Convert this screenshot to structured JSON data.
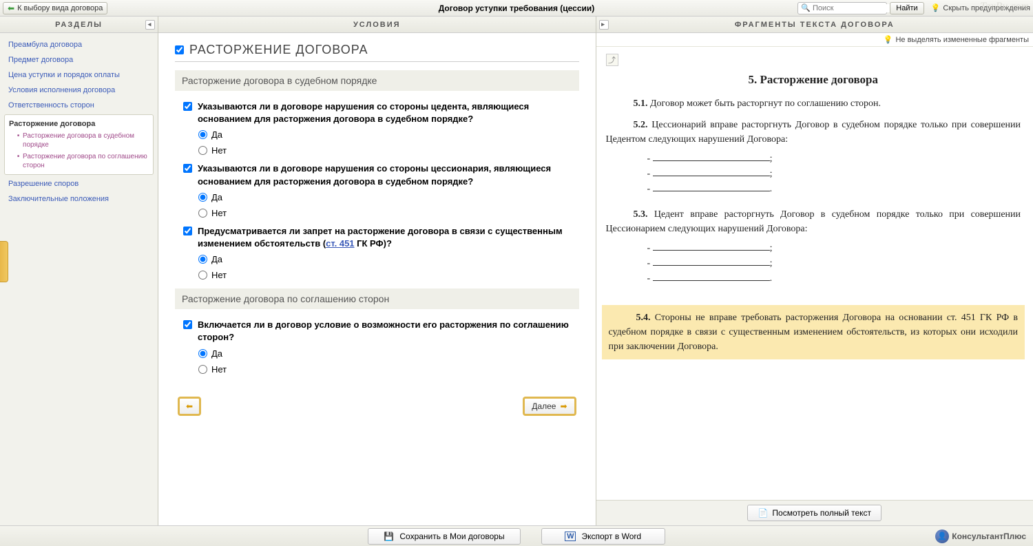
{
  "topbar": {
    "back_label": "К выбору вида договора",
    "title": "Договор уступки требования (цессии)",
    "search_placeholder": "Поиск",
    "find_label": "Найти",
    "hide_warnings": "Скрыть предупреждения",
    "watermark": "TaxRu.com"
  },
  "columns": {
    "sidebar_header": "РАЗДЕЛЫ",
    "conditions_header": "УСЛОВИЯ",
    "fragments_header": "ФРАГМЕНТЫ ТЕКСТА ДОГОВОРА"
  },
  "sidebar": {
    "items": [
      "Преамбула договора",
      "Предмет договора",
      "Цена уступки и порядок оплаты",
      "Условия исполнения договора",
      "Ответственность сторон"
    ],
    "active": {
      "title": "Расторжение договора",
      "subs": [
        "Расторжение договора в судебном порядке",
        "Расторжение договора по соглашению сторон"
      ]
    },
    "after": [
      "Разрешение споров",
      "Заключительные положения"
    ]
  },
  "conditions": {
    "title": "РАСТОРЖЕНИЕ ДОГОВОРА",
    "sub1": "Расторжение договора в судебном порядке",
    "q1": "Указываются ли в договоре нарушения со стороны цедента, являющиеся основанием для расторжения договора в судебном порядке?",
    "q2": "Указываются ли в договоре нарушения со стороны цессионария, являющиеся основанием для расторжения договора в судебном порядке?",
    "q3_a": "Предусматривается ли запрет на расторжение договора в связи с существенным изменением обстоятельств (",
    "q3_link": "ст. 451",
    "q3_b": " ГК РФ)?",
    "sub2": "Расторжение договора по соглашению сторон",
    "q4": "Включается ли в договор условие о возможности его расторжения по соглашению сторон?",
    "yes": "Да",
    "no": "Нет",
    "next": "Далее"
  },
  "fragments": {
    "no_highlight": "Не выделять измененные фрагменты",
    "heading_num": "5.",
    "heading": "Расторжение договора",
    "p51_num": "5.1.",
    "p51": "Договор может быть расторгнут по соглашению сторон.",
    "p52_num": "5.2.",
    "p52": "Цессионарий вправе расторгнуть Договор в судебном порядке только при совершении Цедентом следующих нарушений Договора:",
    "p53_num": "5.3.",
    "p53": "Цедент вправе расторгнуть Договор в судебном порядке только при совершении Цессионарием следующих нарушений Договора:",
    "p54_num": "5.4.",
    "p54": "Стороны не вправе требовать расторжения Договора на основании ст. 451 ГК РФ в судебном порядке в связи с существенным изменением обстоятельств, из которых они исходили при заключении Договора.",
    "view_full": "Посмотреть полный текст"
  },
  "footer": {
    "save": "Сохранить в Мои договоры",
    "export": "Экспорт в Word",
    "brand": "КонсультантПлюс"
  }
}
